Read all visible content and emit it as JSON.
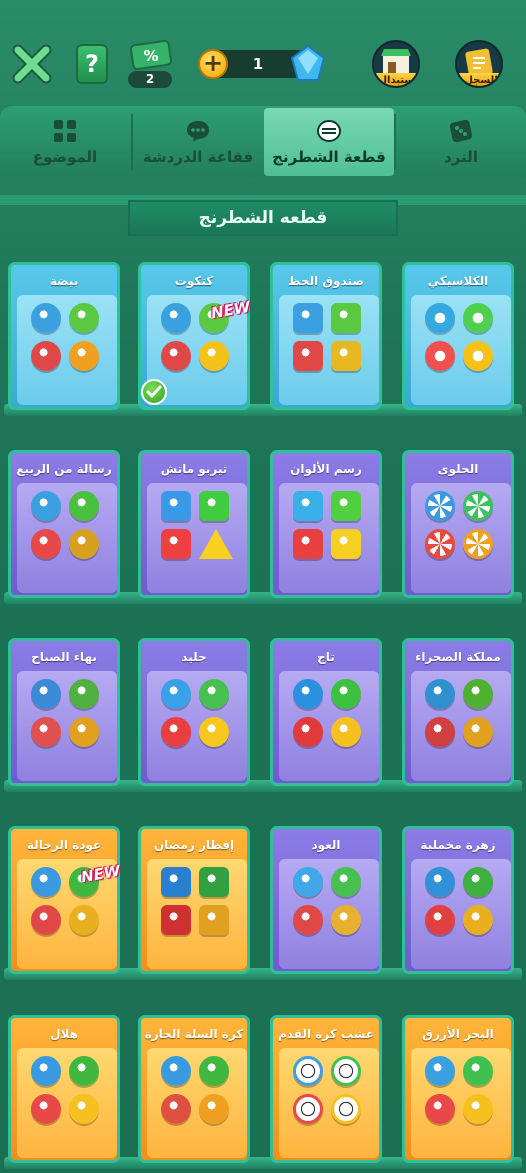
{
  "top_bar": {
    "ticket_count": "2",
    "gem_count": "1",
    "replace_label": "استبدال",
    "history_label": "السجل"
  },
  "tabs": [
    {
      "label": "الموضوع",
      "icon": "grid-icon",
      "active": false
    },
    {
      "label": "فقاعة الدردشة",
      "icon": "chat-bubble-icon",
      "active": false
    },
    {
      "label": "قطعة الشطرنج",
      "icon": "chess-piece-icon",
      "active": true
    },
    {
      "label": "النرد",
      "icon": "dice-icon",
      "active": false
    }
  ],
  "section_title": "قطعه الشطرنج",
  "new_badge": "NEW",
  "rows": [
    [
      {
        "label": "الكلاسيكي",
        "theme": "blue",
        "style": "classic",
        "colors": [
          "#35a9e0",
          "#4fd04f",
          "#f05050",
          "#f5c21a"
        ]
      },
      {
        "label": "صندوق الحظ",
        "theme": "blue",
        "style": "chest",
        "colors": [
          "#3aa0e0",
          "#5ac840",
          "#e04848",
          "#e8b820"
        ]
      },
      {
        "label": "كتكوت",
        "theme": "blue",
        "style": "chick",
        "colors": [
          "#3aa0e0",
          "#5ac840",
          "#e04848",
          "#f5c21a"
        ],
        "new": true,
        "selected": true
      },
      {
        "label": "بيضة",
        "theme": "blue",
        "style": "egg",
        "colors": [
          "#3aa0e0",
          "#5ac840",
          "#e04848",
          "#f0a020"
        ]
      }
    ],
    [
      {
        "label": "الحلوى",
        "theme": "purple",
        "style": "candy",
        "colors": [
          "#3a9ae0",
          "#3cc060",
          "#e84a40",
          "#f0a020"
        ]
      },
      {
        "label": "رسم الألوان",
        "theme": "purple",
        "style": "paint",
        "colors": [
          "#3ab0e8",
          "#50d040",
          "#e84040",
          "#f5d020"
        ]
      },
      {
        "label": "تيربو ماتش",
        "theme": "purple",
        "style": "match",
        "colors": [
          "#3a9ae8",
          "#40cc40",
          "#ee4040",
          "#f8d020"
        ]
      },
      {
        "label": "رسالة من الربيع",
        "theme": "purple",
        "style": "spring",
        "colors": [
          "#3aa0e0",
          "#4ac040",
          "#e84848",
          "#d8a020"
        ]
      }
    ],
    [
      {
        "label": "مملكة الصحراء",
        "theme": "purple",
        "style": "desert",
        "colors": [
          "#3090d0",
          "#50b030",
          "#d04040",
          "#e0a020"
        ]
      },
      {
        "label": "تاج",
        "theme": "purple",
        "style": "crown",
        "colors": [
          "#2a90e0",
          "#3cc040",
          "#e03a3a",
          "#f5c020"
        ]
      },
      {
        "label": "جليد",
        "theme": "purple",
        "style": "ice",
        "colors": [
          "#3aa0e8",
          "#48c050",
          "#e84040",
          "#f5c820"
        ]
      },
      {
        "label": "بهاء الصباح",
        "theme": "purple",
        "style": "flower",
        "colors": [
          "#3a8ad8",
          "#50b040",
          "#e05050",
          "#e0a020"
        ]
      }
    ],
    [
      {
        "label": "زهرة مخملية",
        "theme": "purple",
        "style": "velvet",
        "colors": [
          "#3090d8",
          "#3cb040",
          "#e04040",
          "#e8b020"
        ]
      },
      {
        "label": "العود",
        "theme": "purple",
        "style": "oud",
        "colors": [
          "#40a8e8",
          "#48c050",
          "#e04848",
          "#e8b030"
        ]
      },
      {
        "label": "إفطار رمضان",
        "theme": "orange",
        "style": "lantern",
        "colors": [
          "#2a80d0",
          "#30a040",
          "#d03030",
          "#e0a020"
        ]
      },
      {
        "label": "عودة الرحالة",
        "theme": "orange",
        "style": "anchor",
        "colors": [
          "#3a9ae0",
          "#40b840",
          "#e04848",
          "#e8b020"
        ],
        "new": true
      }
    ],
    [
      {
        "label": "البحر الأزرق",
        "theme": "orange",
        "style": "star",
        "colors": [
          "#3aa0e0",
          "#40c050",
          "#e84848",
          "#f5c020"
        ]
      },
      {
        "label": "عشب كرة القدم",
        "theme": "orange",
        "style": "soccer",
        "colors": [
          "#3aa0e0",
          "#40c050",
          "#e84848",
          "#f5c020"
        ]
      },
      {
        "label": "كرة السلة الحارة",
        "theme": "orange",
        "style": "basketball",
        "colors": [
          "#3a9ae0",
          "#40b840",
          "#e05040",
          "#f0a020"
        ]
      },
      {
        "label": "هلال",
        "theme": "orange",
        "style": "crescent",
        "colors": [
          "#3a9ae0",
          "#40b840",
          "#e84848",
          "#f5c020"
        ]
      }
    ]
  ]
}
